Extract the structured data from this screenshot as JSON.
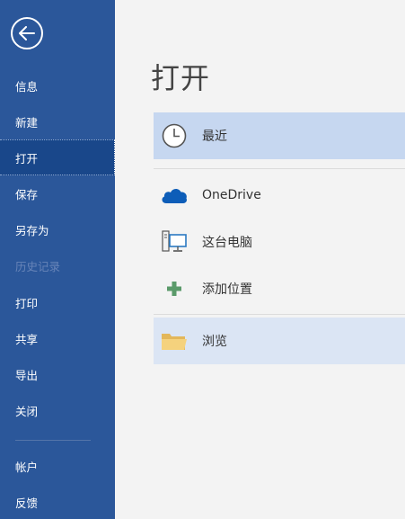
{
  "sidebar": {
    "back_icon": "back-arrow-icon",
    "items": [
      {
        "label": "信息"
      },
      {
        "label": "新建"
      },
      {
        "label": "打开"
      },
      {
        "label": "保存"
      },
      {
        "label": "另存为"
      },
      {
        "label": "历史记录"
      },
      {
        "label": "打印"
      },
      {
        "label": "共享"
      },
      {
        "label": "导出"
      },
      {
        "label": "关闭"
      },
      {
        "label": "帐户"
      },
      {
        "label": "反馈"
      }
    ]
  },
  "main": {
    "title": "打开",
    "locations": [
      {
        "label": "最近",
        "icon": "clock-icon"
      },
      {
        "label": "OneDrive",
        "icon": "cloud-icon"
      },
      {
        "label": "这台电脑",
        "icon": "computer-icon"
      },
      {
        "label": "添加位置",
        "icon": "plus-icon"
      },
      {
        "label": "浏览",
        "icon": "folder-icon"
      }
    ]
  },
  "colors": {
    "sidebar_bg": "#2b579a",
    "sidebar_active": "#19478a",
    "selected_bg": "#c6d7f0",
    "accent_blue": "#2b579a"
  }
}
